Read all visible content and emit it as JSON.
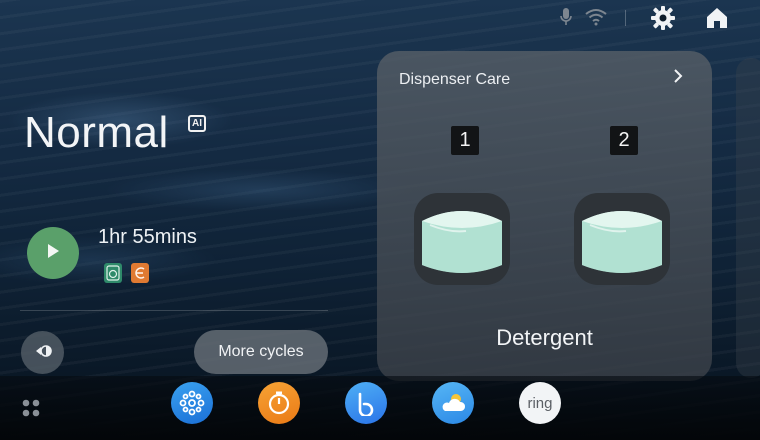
{
  "status_bar": {
    "icons": [
      "mic-icon",
      "wifi-icon",
      "settings-gear-icon",
      "home-icon"
    ]
  },
  "cycle": {
    "name": "Normal",
    "ai_badge": "AI",
    "time_remaining": "1hr 55mins",
    "option_icons": [
      "washer-option-icon",
      "eco-option-icon"
    ],
    "option_colors": [
      "#2f8a6a",
      "#e07a32"
    ]
  },
  "controls": {
    "play_icon": "play-icon",
    "rinse_icon": "rinse-spin-icon",
    "more_cycles_label": "More cycles"
  },
  "dispenser_card": {
    "title": "Dispenser Care",
    "slots": [
      {
        "number": "1"
      },
      {
        "number": "2"
      }
    ],
    "label": "Detergent"
  },
  "dock": {
    "apps": [
      {
        "icon": "smartthings-icon"
      },
      {
        "icon": "timer-icon"
      },
      {
        "icon": "bixby-icon"
      },
      {
        "icon": "weather-icon"
      },
      {
        "label": "ring",
        "icon": "ring-icon"
      }
    ]
  },
  "colors": {
    "play_button": "#5aa06a",
    "card_background": "#565e66"
  }
}
